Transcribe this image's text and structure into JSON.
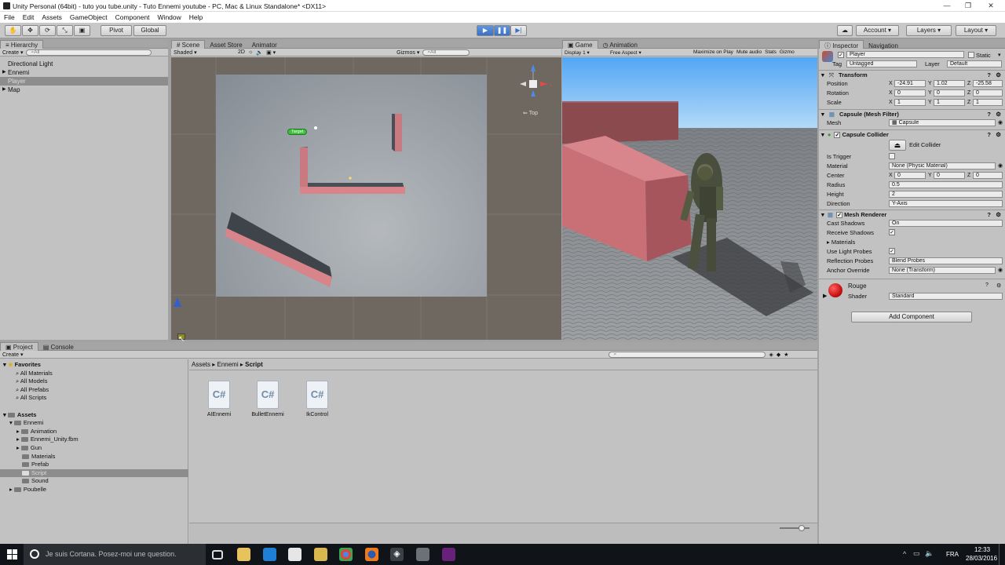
{
  "window": {
    "title": "Unity Personal (64bit) - tuto you tube.unity - Tuto Ennemi youtube - PC, Mac & Linux Standalone* <DX11>",
    "minimize": "—",
    "maximize": "❐",
    "close": "✕"
  },
  "menu": [
    "File",
    "Edit",
    "Assets",
    "GameObject",
    "Component",
    "Window",
    "Help"
  ],
  "toolbar": {
    "pivot": "Pivot",
    "global": "Global",
    "account": "Account",
    "layers": "Layers",
    "layout": "Layout"
  },
  "hierarchy": {
    "tab": "Hierarchy",
    "create": "Create",
    "search_placeholder": "All",
    "items": [
      "Directional Light",
      "Ennemi",
      "Player",
      "Map"
    ]
  },
  "scene": {
    "tabs": [
      "Scene",
      "Asset Store",
      "Animator"
    ],
    "shading": "Shaded",
    "mode2d": "2D",
    "gizmos": "Gizmos",
    "search_placeholder": "All",
    "target_label": "Target",
    "view_label": "Top"
  },
  "game": {
    "tabs": [
      "Game",
      "Animation"
    ],
    "display": "Display 1",
    "aspect": "Free Aspect",
    "options": [
      "Maximize on Play",
      "Mute audio",
      "Stats",
      "Gizmo"
    ]
  },
  "inspector": {
    "tabs": [
      "Inspector",
      "Navigation"
    ],
    "object_name": "Player",
    "static_label": "Static",
    "tag_label": "Tag",
    "tag_value": "Untagged",
    "layer_label": "Layer",
    "layer_value": "Default",
    "transform": {
      "title": "Transform",
      "position_label": "Position",
      "rotation_label": "Rotation",
      "scale_label": "Scale",
      "position": [
        "-24.91",
        "1.02",
        "-25.58"
      ],
      "rotation": [
        "0",
        "0",
        "0"
      ],
      "scale": [
        "1",
        "1",
        "1"
      ]
    },
    "mesh_filter": {
      "title": "Capsule (Mesh Filter)",
      "mesh_label": "Mesh",
      "mesh_value": "Capsule"
    },
    "capsule_collider": {
      "title": "Capsule Collider",
      "edit_label": "Edit Collider",
      "is_trigger_label": "Is Trigger",
      "material_label": "Material",
      "material_value": "None (Physic Material)",
      "center_label": "Center",
      "center": [
        "0",
        "0",
        "0"
      ],
      "radius_label": "Radius",
      "radius_value": "0.5",
      "height_label": "Height",
      "height_value": "2",
      "direction_label": "Direction",
      "direction_value": "Y-Axis"
    },
    "mesh_renderer": {
      "title": "Mesh Renderer",
      "cast_shadows_label": "Cast Shadows",
      "cast_shadows_value": "On",
      "receive_shadows_label": "Receive Shadows",
      "materials_label": "Materials",
      "light_probes_label": "Use Light Probes",
      "reflection_label": "Reflection Probes",
      "reflection_value": "Blend Probes",
      "anchor_label": "Anchor Override",
      "anchor_value": "None (Transform)"
    },
    "material": {
      "name": "Rouge",
      "shader_label": "Shader",
      "shader_value": "Standard",
      "color": "#d01818"
    },
    "add_component": "Add Component"
  },
  "project": {
    "tabs": [
      "Project",
      "Console"
    ],
    "create": "Create",
    "favorites_label": "Favorites",
    "favorites": [
      "All Materials",
      "All Models",
      "All Prefabs",
      "All Scripts"
    ],
    "assets_label": "Assets",
    "tree": [
      "Ennemi",
      "Animation",
      "Ennemi_Unity.fbm",
      "Gun",
      "Materials",
      "Prefab",
      "Script",
      "Sound",
      "Poubelle"
    ],
    "breadcrumb": [
      "Assets",
      "Ennemi",
      "Script"
    ],
    "breadcrumb_sep": "▸",
    "files": [
      "AIEnnemi",
      "BulletEnnemi",
      "IkControl"
    ],
    "file_icon": "C#"
  },
  "taskbar": {
    "cortana": "Je suis Cortana. Posez-moi une question.",
    "lang": "FRA",
    "time": "12:33",
    "date": "28/03/2016"
  }
}
